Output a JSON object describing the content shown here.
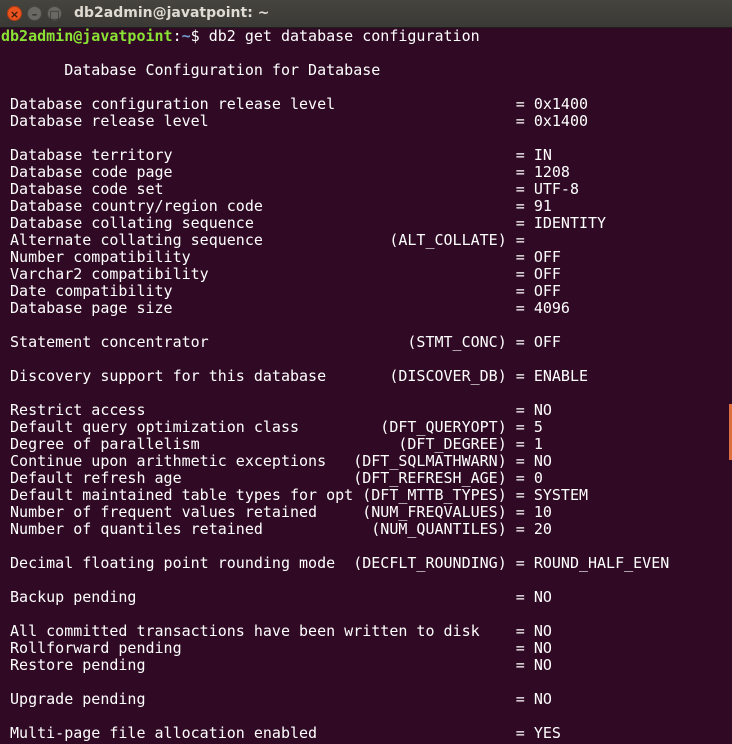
{
  "window": {
    "title": "db2admin@javatpoint: ~",
    "close_glyph": "×",
    "min_glyph": "–",
    "max_glyph": "□"
  },
  "prompt": {
    "user_host": "db2admin@javatpoint",
    "sep": ":",
    "path": "~",
    "symbol": "$ ",
    "command": "db2 get database configuration"
  },
  "lines": [
    "",
    "       Database Configuration for Database",
    "",
    " Database configuration release level                    = 0x1400",
    " Database release level                                  = 0x1400",
    "",
    " Database territory                                      = IN",
    " Database code page                                      = 1208",
    " Database code set                                       = UTF-8",
    " Database country/region code                            = 91",
    " Database collating sequence                             = IDENTITY",
    " Alternate collating sequence              (ALT_COLLATE) =",
    " Number compatibility                                    = OFF",
    " Varchar2 compatibility                                  = OFF",
    " Date compatibility                                      = OFF",
    " Database page size                                      = 4096",
    "",
    " Statement concentrator                      (STMT_CONC) = OFF",
    "",
    " Discovery support for this database       (DISCOVER_DB) = ENABLE",
    "",
    " Restrict access                                         = NO",
    " Default query optimization class         (DFT_QUERYOPT) = 5",
    " Degree of parallelism                      (DFT_DEGREE) = 1",
    " Continue upon arithmetic exceptions   (DFT_SQLMATHWARN) = NO",
    " Default refresh age                   (DFT_REFRESH_AGE) = 0",
    " Default maintained table types for opt (DFT_MTTB_TYPES) = SYSTEM",
    " Number of frequent values retained     (NUM_FREQVALUES) = 10",
    " Number of quantiles retained            (NUM_QUANTILES) = 20",
    "",
    " Decimal floating point rounding mode  (DECFLT_ROUNDING) = ROUND_HALF_EVEN",
    "",
    " Backup pending                                          = NO",
    "",
    " All committed transactions have been written to disk    = NO",
    " Rollforward pending                                     = NO",
    " Restore pending                                         = NO",
    "",
    " Upgrade pending                                         = NO",
    "",
    " Multi-page file allocation enabled                      = YES"
  ],
  "colors": {
    "background": "#300a24",
    "text": "#ffffff",
    "prompt_user": "#8ae234",
    "prompt_path": "#729fcf",
    "close_button": "#e9541f"
  }
}
